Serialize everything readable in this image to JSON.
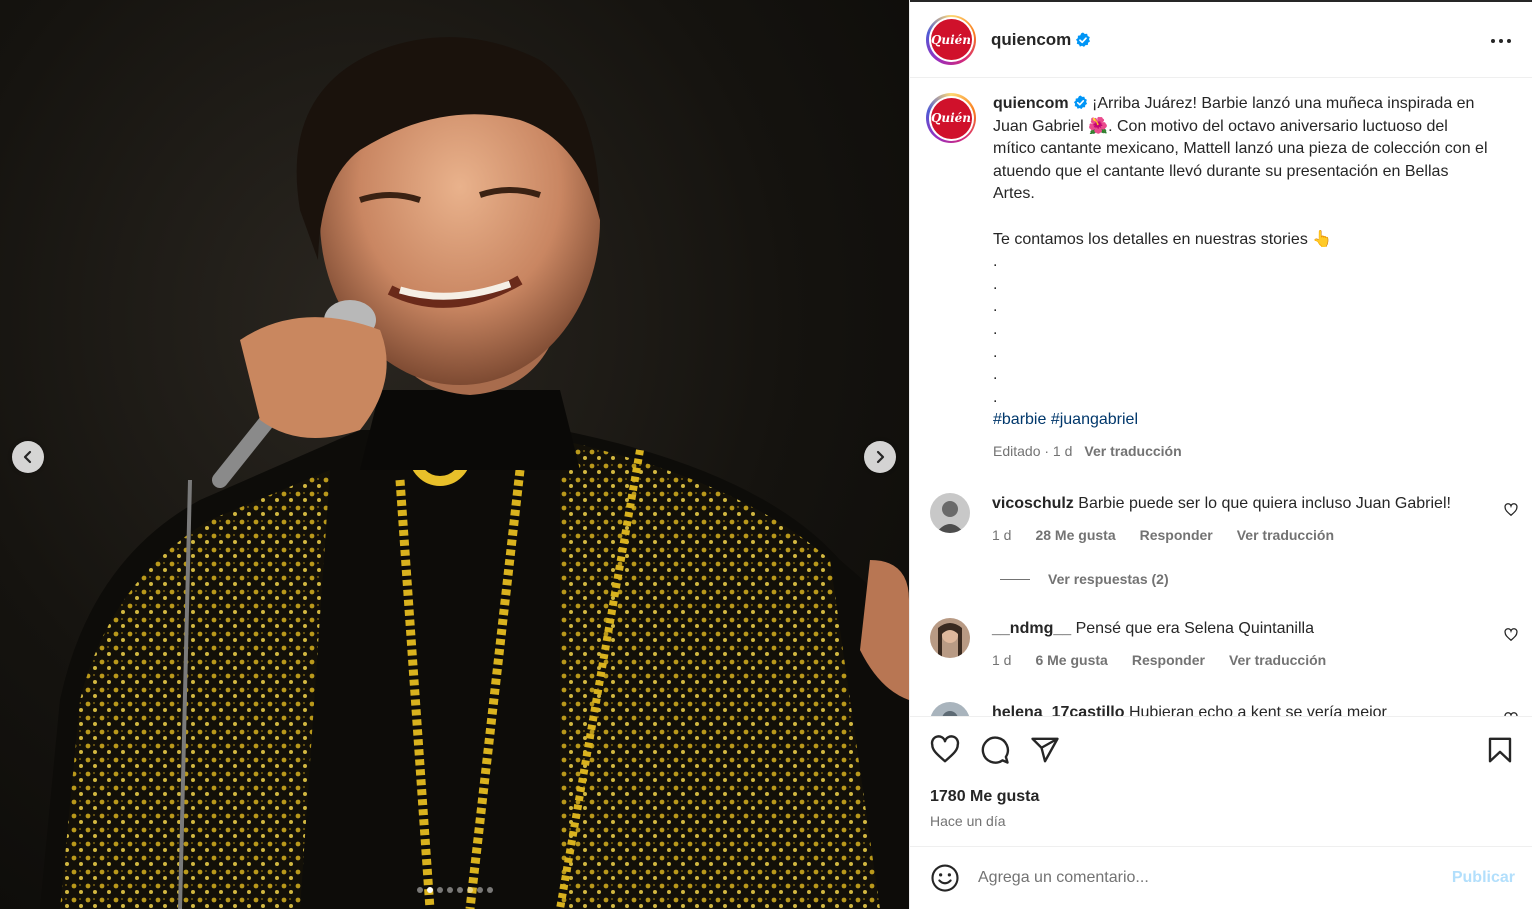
{
  "post": {
    "username": "quiencom",
    "avatar_text": "Quién",
    "caption_username": "quiencom",
    "caption_text_1": "¡Arriba Juárez! Barbie lanzó una muñeca inspirada en Juan Gabriel ",
    "caption_flower": "🌺",
    "caption_text_2": ". Con motivo del octavo aniversario luctuoso del mítico cantante mexicano, Mattell lanzó una pieza de colección con el atuendo que el cantante llevó durante su presentación en Bellas Artes.",
    "caption_text_3": "Te contamos los detalles en nuestras stories ",
    "caption_point": "👆",
    "caption_dots": [
      ".",
      ".",
      ".",
      ".",
      ".",
      ".",
      "."
    ],
    "hashtag_1": "#barbie",
    "hashtag_2": "#juangabriel",
    "edited_label": "Editado · 1 d",
    "translate_label": "Ver traducción"
  },
  "comments": [
    {
      "username": "vicoschulz",
      "text": "Barbie puede ser lo que quiera incluso Juan Gabriel!",
      "time": "1 d",
      "likes": "28 Me gusta",
      "reply": "Responder",
      "translate": "Ver traducción",
      "replies_label": "Ver respuestas (2)"
    },
    {
      "username": "__ndmg__",
      "text": "Pensé que era Selena Quintanilla",
      "time": "1 d",
      "likes": "6 Me gusta",
      "reply": "Responder",
      "translate": "Ver traducción"
    },
    {
      "username": "helena_17castillo",
      "text": "Hubieran echo a kent se vería mejor"
    }
  ],
  "footer": {
    "likes": "1780 Me gusta",
    "time_ago": "Hace un día",
    "comment_placeholder": "Agrega un comentario...",
    "publish_label": "Publicar"
  },
  "carousel": {
    "slide_count": 8,
    "active_index": 1
  },
  "colors": {
    "brand_red": "#d0112b",
    "verified_blue": "#0095f6",
    "publish_disabled": "#b2dffc"
  },
  "icons": [
    "chevron-left-icon",
    "chevron-right-icon",
    "verified-badge-icon",
    "more-options-icon",
    "heart-icon",
    "comment-icon",
    "share-icon",
    "bookmark-icon",
    "emoji-icon"
  ]
}
